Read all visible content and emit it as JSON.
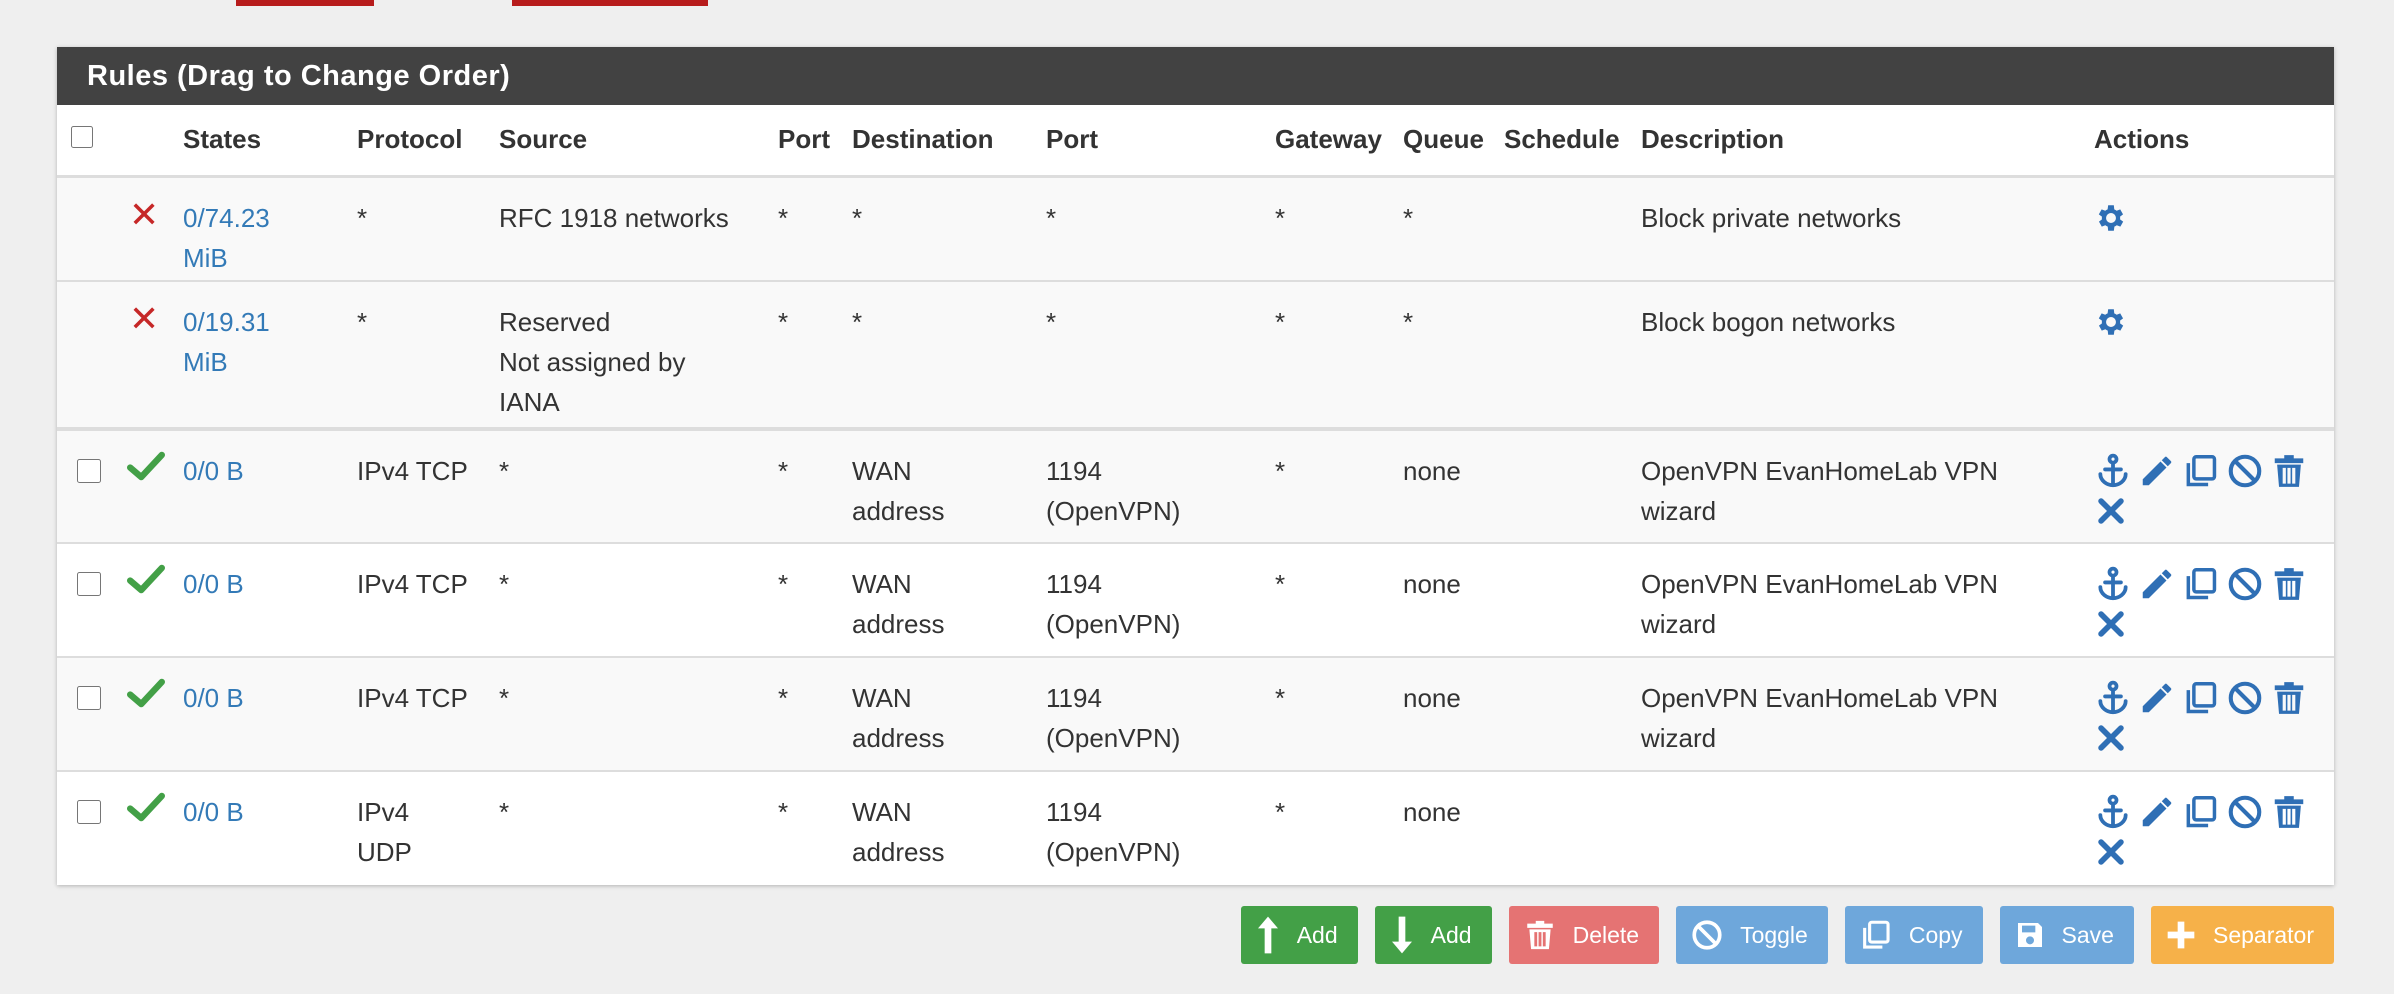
{
  "panel": {
    "title": "Rules (Drag to Change Order)"
  },
  "columns": {
    "states": "States",
    "protocol": "Protocol",
    "source": "Source",
    "source_port": "Port",
    "destination": "Destination",
    "dest_port": "Port",
    "gateway": "Gateway",
    "queue": "Queue",
    "schedule": "Schedule",
    "description": "Description",
    "actions": "Actions"
  },
  "system_rows": [
    {
      "status": "blocked",
      "states_line1": "0/74.23",
      "states_line2": "MiB",
      "protocol": "*",
      "source_line1": "RFC 1918 networks",
      "source_line2": "",
      "source_line3": "",
      "source_port": "*",
      "destination": "*",
      "dest_port": "*",
      "gateway": "*",
      "queue": "*",
      "schedule": "",
      "description": "Block private networks"
    },
    {
      "status": "blocked",
      "states_line1": "0/19.31",
      "states_line2": "MiB",
      "protocol": "*",
      "source_line1": "Reserved",
      "source_line2": "Not assigned by",
      "source_line3": "IANA",
      "source_port": "*",
      "destination": "*",
      "dest_port": "*",
      "gateway": "*",
      "queue": "*",
      "schedule": "",
      "description": "Block bogon networks"
    }
  ],
  "rows": [
    {
      "status": "pass",
      "states": "0/0 B",
      "protocol_line1": "IPv4 TCP",
      "protocol_line2": "",
      "source": "*",
      "source_port": "*",
      "dest_line1": "WAN",
      "dest_line2": "address",
      "dport_line1": "1194",
      "dport_line2": "(OpenVPN)",
      "gateway": "*",
      "queue": "none",
      "schedule": "",
      "desc_line1": "OpenVPN EvanHomeLab VPN",
      "desc_line2": "wizard"
    },
    {
      "status": "pass",
      "states": "0/0 B",
      "protocol_line1": "IPv4 TCP",
      "protocol_line2": "",
      "source": "*",
      "source_port": "*",
      "dest_line1": "WAN",
      "dest_line2": "address",
      "dport_line1": "1194",
      "dport_line2": "(OpenVPN)",
      "gateway": "*",
      "queue": "none",
      "schedule": "",
      "desc_line1": "OpenVPN EvanHomeLab VPN",
      "desc_line2": "wizard"
    },
    {
      "status": "pass",
      "states": "0/0 B",
      "protocol_line1": "IPv4 TCP",
      "protocol_line2": "",
      "source": "*",
      "source_port": "*",
      "dest_line1": "WAN",
      "dest_line2": "address",
      "dport_line1": "1194",
      "dport_line2": "(OpenVPN)",
      "gateway": "*",
      "queue": "none",
      "schedule": "",
      "desc_line1": "OpenVPN EvanHomeLab VPN",
      "desc_line2": "wizard"
    },
    {
      "status": "pass",
      "states": "0/0 B",
      "protocol_line1": "IPv4",
      "protocol_line2": "UDP",
      "source": "*",
      "source_port": "*",
      "dest_line1": "WAN",
      "dest_line2": "address",
      "dport_line1": "1194",
      "dport_line2": "(OpenVPN)",
      "gateway": "*",
      "queue": "none",
      "schedule": "",
      "desc_line1": "",
      "desc_line2": ""
    }
  ],
  "buttons": {
    "add_top": "Add",
    "add_bottom": "Add",
    "delete": "Delete",
    "toggle": "Toggle",
    "copy": "Copy",
    "save": "Save",
    "separator": "Separator"
  },
  "colors": {
    "header_bg": "#424242",
    "link": "#337ab7",
    "pass_green": "#43a047",
    "block_red": "#c62828",
    "icon_blue": "#2f6fb5",
    "btn_green": "#43a047",
    "btn_red": "#e57373",
    "btn_blue": "#6ea7db",
    "btn_orange": "#f6b149"
  },
  "icons": {
    "blocked": "x-mark-icon",
    "pass": "check-icon",
    "system_action": "gear-icon",
    "row_actions": [
      "anchor-icon",
      "pencil-icon",
      "copy-icon",
      "disable-icon",
      "trash-icon",
      "x-icon"
    ]
  }
}
